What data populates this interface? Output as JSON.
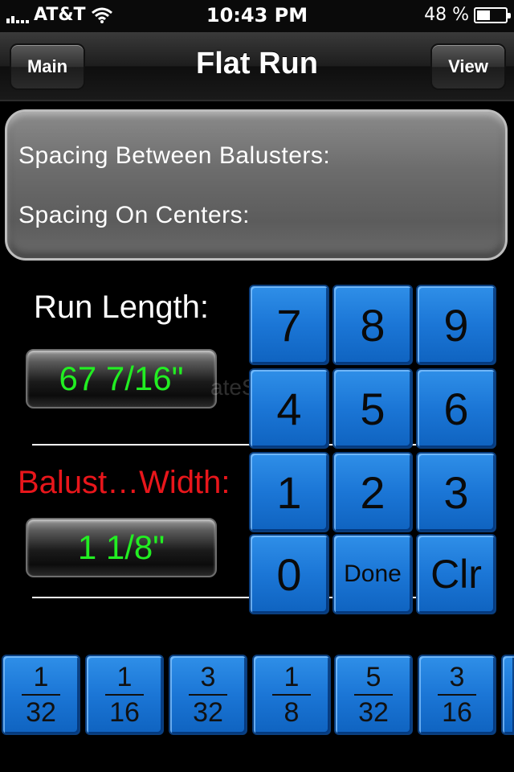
{
  "status_bar": {
    "carrier": "AT&T",
    "time": "10:43 PM",
    "battery": "48 %",
    "battery_level": 0.48
  },
  "nav": {
    "title": "Flat Run",
    "left_button": "Main",
    "right_button": "View"
  },
  "results": {
    "between_label": "Spacing Between Balusters:",
    "centers_label": "Spacing On Centers:"
  },
  "inputs": {
    "run_length_label": "Run Length:",
    "run_length_value": "67 7/16\"",
    "baluster_width_label": "Balust…Width:",
    "baluster_width_value": "1 1/8\""
  },
  "watermark": "ateStar.com",
  "keypad": [
    "7",
    "8",
    "9",
    "4",
    "5",
    "6",
    "1",
    "2",
    "3",
    "0",
    "Done",
    "Clr"
  ],
  "fractions": [
    {
      "num": "1",
      "den": "32"
    },
    {
      "num": "1",
      "den": "16"
    },
    {
      "num": "3",
      "den": "32"
    },
    {
      "num": "1",
      "den": "8"
    },
    {
      "num": "5",
      "den": "32"
    },
    {
      "num": "3",
      "den": "16"
    }
  ],
  "colors": {
    "value_text": "#22ee22",
    "warning_label": "#e8161b",
    "key_blue": "#1b76d6"
  }
}
